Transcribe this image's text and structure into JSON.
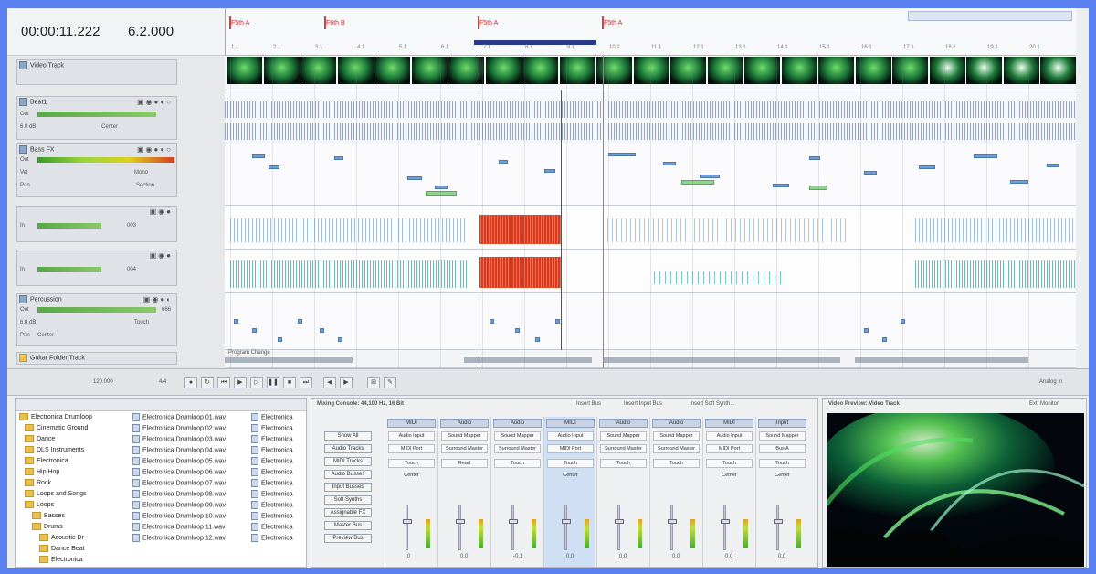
{
  "header": {
    "time": "00:00:11.222",
    "tempo": "6.2.000"
  },
  "ruler": {
    "markers": [
      "F5th A",
      "F6th B",
      "F5th A",
      "F5th A"
    ],
    "ticks": [
      "1.1",
      "2.1",
      "3.1",
      "4.1",
      "5.1",
      "6.1",
      "7.1",
      "8.1",
      "9.1",
      "10.1",
      "11.1",
      "12.1",
      "13.1",
      "14.1",
      "15.1",
      "16.1",
      "17.1",
      "18.1",
      "19.1",
      "20.1"
    ]
  },
  "tracks": {
    "video": {
      "name": "Video Track"
    },
    "beat": {
      "name": "Beat1",
      "out": "Out",
      "vol": "6.0 dB",
      "pan": "Center"
    },
    "bass": {
      "name": "Bass FX",
      "out": "Out",
      "vol": "Vel",
      "pan": "Pan",
      "fx": "Mono",
      "sec": "Section"
    },
    "t3": {
      "in": "In",
      "out": "003"
    },
    "t4": {
      "in": "In",
      "out": "004"
    },
    "perc": {
      "name": "Percussion",
      "out": "Out",
      "vol": "6.0 dB",
      "pan": "Pan",
      "center": "Center",
      "touch": "Touch",
      "num": "666"
    },
    "guitar": {
      "name": "Guitar Folder Track"
    }
  },
  "timeline": {
    "program_change": "Program Change"
  },
  "transport": {
    "tempo": "120.000",
    "meter": "4/4",
    "analog": "Analog In"
  },
  "explorer": {
    "folders": [
      "Electronica Drumloop",
      "Cinematic Ground",
      "Dance",
      "DLS Instruments",
      "Electronica",
      "Hip Hop",
      "Rock",
      "Loops and Songs",
      "Loops",
      "Basses",
      "Drums",
      "Acoustic Dr",
      "Dance Beat",
      "Electronica"
    ],
    "files": [
      "Electronica Drumloop 01.wav",
      "Electronica Drumloop 02.wav",
      "Electronica Drumloop 03.wav",
      "Electronica Drumloop 04.wav",
      "Electronica Drumloop 05.wav",
      "Electronica Drumloop 06.wav",
      "Electronica Drumloop 07.wav",
      "Electronica Drumloop 08.wav",
      "Electronica Drumloop 09.wav",
      "Electronica Drumloop 10.wav",
      "Electronica Drumloop 11.wav",
      "Electronica Drumloop 12.wav"
    ],
    "files2": [
      "Electronica",
      "Electronica",
      "Electronica",
      "Electronica",
      "Electronica",
      "Electronica",
      "Electronica",
      "Electronica",
      "Electronica",
      "Electronica",
      "Electronica",
      "Electronica"
    ]
  },
  "mixer": {
    "title": "Mixing Console: 44,100 Hz, 16 Bit",
    "toolbar": {
      "insert_bus": "Insert Bus",
      "insert_input_bus": "Insert Input Bus",
      "insert_soft_synth": "Insert Soft Synth..."
    },
    "left_buttons": [
      "Show All",
      "Audio Tracks",
      "MIDI Tracks",
      "Audio Busses",
      "Input Busses",
      "Soft Synths",
      "Assignable FX",
      "Master Bus",
      "Preview Bus"
    ],
    "strips": [
      {
        "type": "MIDI",
        "a": "Audio Input",
        "b": "MIDI Port",
        "auto": "Touch",
        "pan": "Center",
        "val": "0"
      },
      {
        "type": "Audio",
        "a": "Sound Mapper",
        "b": "Surround Master",
        "auto": "Read",
        "pan": "",
        "val": "0.0"
      },
      {
        "type": "Audio",
        "a": "Sound Mapper",
        "b": "Surround Master",
        "auto": "Touch",
        "pan": "",
        "val": "-0.1"
      },
      {
        "type": "MIDI",
        "a": "Audio Input",
        "b": "MIDI Port",
        "auto": "Touch",
        "pan": "Center",
        "val": "0.0"
      },
      {
        "type": "Audio",
        "a": "Sound Mapper",
        "b": "Surround Master",
        "auto": "Touch",
        "pan": "",
        "val": "0.0"
      },
      {
        "type": "Audio",
        "a": "Sound Mapper",
        "b": "Surround Master",
        "auto": "Touch",
        "pan": "",
        "val": "0.0"
      },
      {
        "type": "MIDI",
        "a": "Audio Input",
        "b": "MIDI Port",
        "auto": "Touch",
        "pan": "Center",
        "val": "0.0"
      },
      {
        "type": "Input",
        "a": "Sound Mapper",
        "b": "Bus A",
        "auto": "Touch",
        "pan": "Center",
        "val": "0.0"
      }
    ]
  },
  "preview": {
    "title": "Video Preview: Video Track",
    "ext": "Ext. Monitor"
  }
}
